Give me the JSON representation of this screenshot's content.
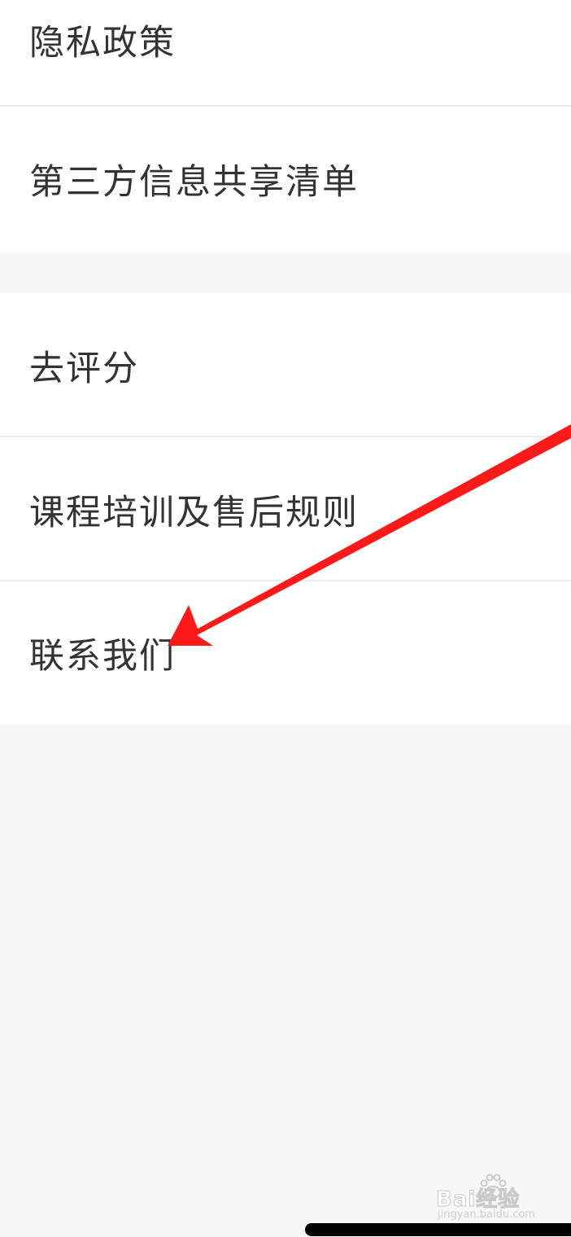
{
  "menu": {
    "group1": [
      {
        "label": "隐私政策"
      },
      {
        "label": "第三方信息共享清单"
      }
    ],
    "group2": [
      {
        "label": "去评分"
      },
      {
        "label": "课程培训及售后规则"
      },
      {
        "label": "联系我们"
      }
    ]
  },
  "annotation": {
    "color": "#ff1a1a",
    "icon": "red-arrow-icon",
    "points_to": "联系我们"
  },
  "watermark": {
    "main": "Bai经验",
    "sub": "jingyan.baidu.com"
  },
  "colors": {
    "background": "#f7f7f7",
    "row_background": "#ffffff",
    "text": "#333333",
    "divider": "#ececec"
  }
}
